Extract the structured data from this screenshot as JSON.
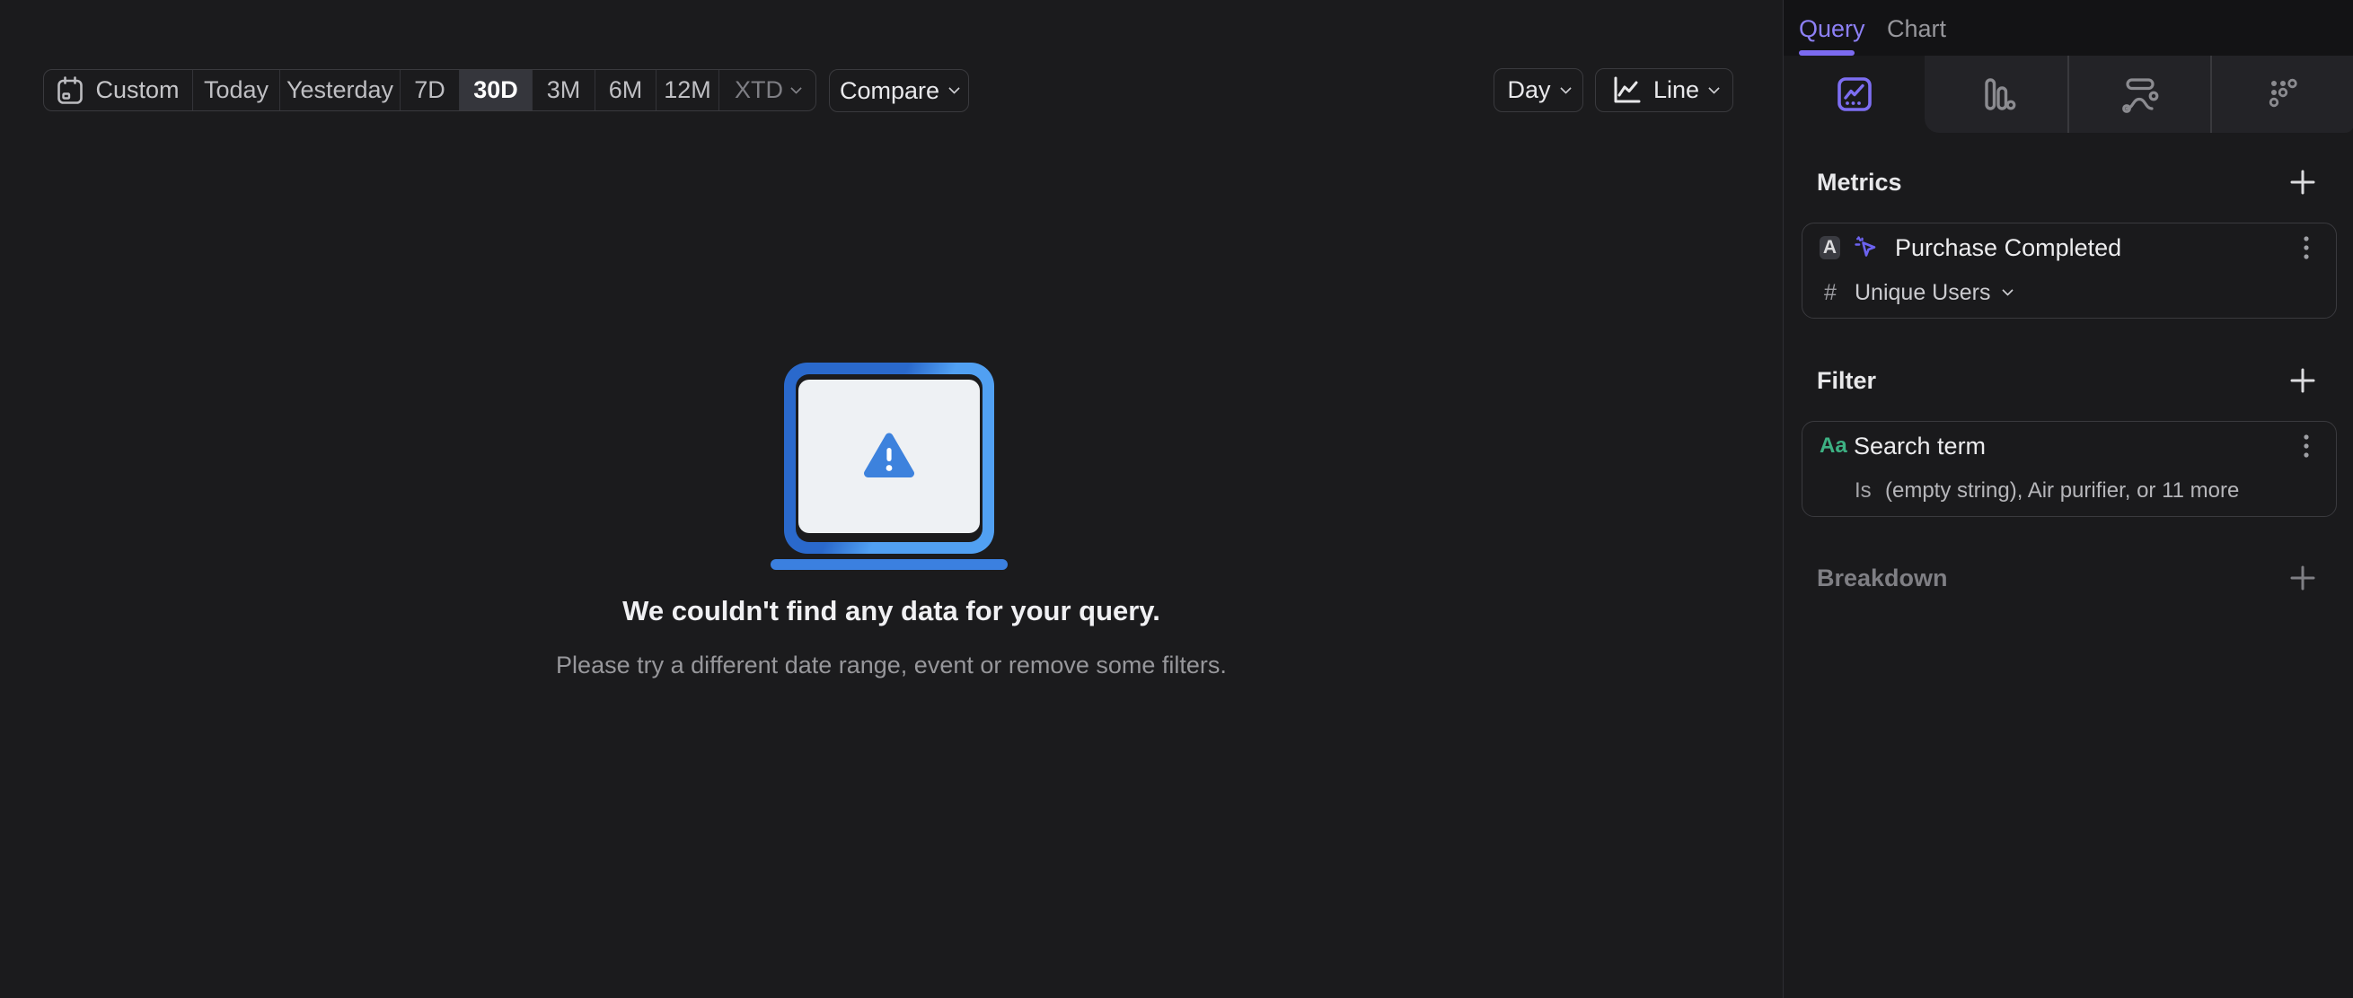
{
  "toolbar": {
    "date_ranges": [
      {
        "label": "Custom"
      },
      {
        "label": "Today"
      },
      {
        "label": "Yesterday"
      },
      {
        "label": "7D"
      },
      {
        "label": "30D",
        "selected": true
      },
      {
        "label": "3M"
      },
      {
        "label": "6M"
      },
      {
        "label": "12M"
      },
      {
        "label": "XTD",
        "has_dropdown": true
      }
    ],
    "selected_range": "30D",
    "compare_label": "Compare",
    "granularity_label": "Day",
    "chart_type_label": "Line"
  },
  "empty_state": {
    "title": "We couldn't find any data for your query.",
    "subtitle": "Please try a different date range, event or remove some filters."
  },
  "sidebar": {
    "tabs": [
      {
        "label": "Query",
        "active": true
      },
      {
        "label": "Chart",
        "active": false
      }
    ],
    "view_tabs": [
      {
        "icon": "insights-icon",
        "active": true
      },
      {
        "icon": "bar-chart-icon",
        "active": false
      },
      {
        "icon": "flows-icon",
        "active": false
      },
      {
        "icon": "retention-icon",
        "active": false
      }
    ],
    "metrics": {
      "heading": "Metrics",
      "items": [
        {
          "letter": "A",
          "event": "Purchase Completed",
          "aggregation_symbol": "#",
          "aggregation": "Unique Users"
        }
      ]
    },
    "filter": {
      "heading": "Filter",
      "items": [
        {
          "type_label": "Aa",
          "property": "Search term",
          "operator": "Is",
          "values": "(empty string), Air purifier, or 11 more"
        }
      ]
    },
    "breakdown": {
      "heading": "Breakdown"
    }
  },
  "colors": {
    "accent_purple": "#7c6cf0",
    "event_icon_purple": "#6c63f0",
    "filter_green": "#3db183",
    "laptop_blue_dark": "#2a69cc",
    "laptop_blue_light": "#51a0f2",
    "warning_blue": "#3d82dd",
    "selected_range_bg": "#35363c"
  }
}
